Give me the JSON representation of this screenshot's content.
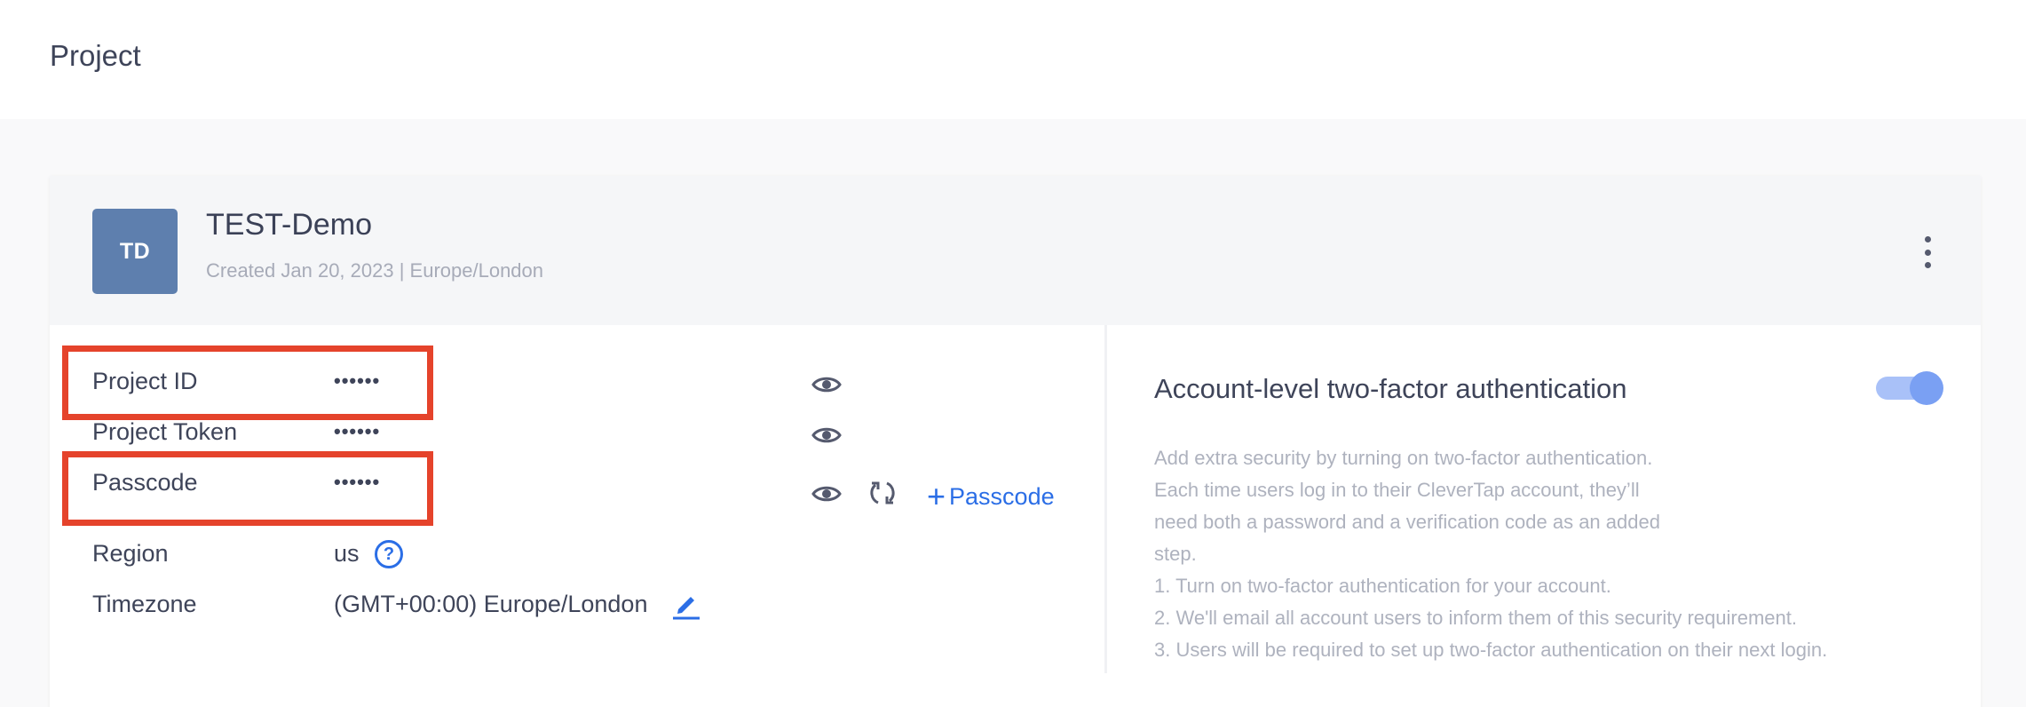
{
  "header": {
    "title": "Project"
  },
  "project": {
    "avatar_initials": "TD",
    "name": "TEST-Demo",
    "meta": "Created Jan 20, 2023 | Europe/London"
  },
  "details": {
    "project_id": {
      "label": "Project ID",
      "value": "••••••"
    },
    "project_token": {
      "label": "Project Token",
      "value": "••••••"
    },
    "passcode": {
      "label": "Passcode",
      "value": "••••••",
      "add_label": "Passcode"
    },
    "region": {
      "label": "Region",
      "value": "us",
      "help": "?"
    },
    "timezone": {
      "label": "Timezone",
      "value": "(GMT+00:00) Europe/London"
    }
  },
  "two_factor": {
    "title": "Account-level two-factor authentication",
    "enabled": true,
    "description": [
      "Add extra security by turning on two-factor authentication.",
      "Each time users log in to their CleverTap account, they’ll",
      "need both a password and a verification code as an added",
      "step.",
      "1. Turn on two-factor authentication for your account.",
      "2. We'll email all account users to inform them of this security requirement.",
      "3. Users will be required to set up two-factor authentication on their next login."
    ]
  },
  "colors": {
    "accent": "#2b6ee6",
    "avatar": "#5e7fae",
    "highlight": "#e5432b",
    "toggle_on": "#7aa0f3"
  },
  "icons": {
    "reveal": "eye-icon",
    "regenerate": "refresh-icon",
    "edit": "pencil-icon",
    "more": "kebab-menu-icon",
    "help": "question-circle-icon",
    "add": "plus-icon"
  }
}
